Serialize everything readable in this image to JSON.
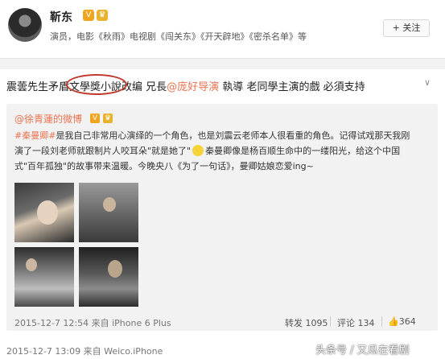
{
  "header": {
    "name": "靳东",
    "badge_v": "V",
    "badge_crown": "♛",
    "description": "演员，电影《秋雨》电视剧《闯关东》《开天辟地》《密杀名单》等",
    "follow_label": "+ 关注"
  },
  "post": {
    "part1": "震蕓先生",
    "circled": "矛盾文學獎",
    "part2": "小說改编  兄長",
    "mention": "@庞好导演",
    "part3": " 執導 老同學主演的戲 必須支持",
    "menu_icon": "chevron-down-icon"
  },
  "repost": {
    "user": "@徐青蓮的微博",
    "line1_topic": "#秦曼卿#",
    "line1_text": "是我自己非常用心演绎的一个角色，也是刘震云老师本人很看重的角色。记得试戏那天我刚",
    "line2_a": "演了一段刘老师就跟制片人咬耳朵\"就是她了\"",
    "line2_b": "秦曼卿像是杨百顺生命中的一缕阳光，给这个中国",
    "line3": "式\"百年孤独\"的故事带来温暖。今晚央八《为了一句话》，曼卿姑娘恋爱ing~",
    "time": "2015-12-7 12:54 来自 iPhone 6 Plus",
    "repost_label": "转发 1095",
    "comment_label": "评论 134",
    "like_count": "364"
  },
  "footer": {
    "time": "2015-12-7 13:09 来自 Weico.iPhone",
    "watermark": "头条号 / 又瓜在看剧"
  }
}
